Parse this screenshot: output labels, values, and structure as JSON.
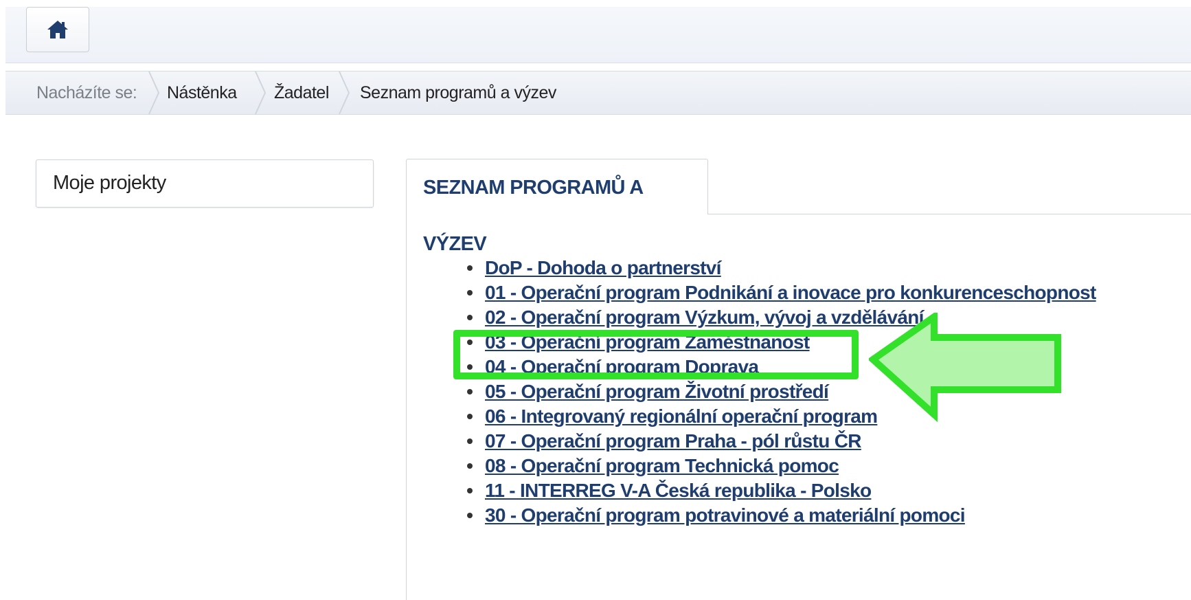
{
  "header": {
    "home_icon": "home-icon"
  },
  "breadcrumb": {
    "prefix": "Nacházíte se:",
    "items": [
      "Nástěnka",
      "Žadatel",
      "Seznam programů a výzev"
    ]
  },
  "sidebar": {
    "my_projects_label": "Moje projekty"
  },
  "main": {
    "tab_label": "SEZNAM PROGRAMŮ A VÝZEV",
    "programs": [
      "DoP - Dohoda o partnerství",
      "01 - Operační program Podnikání a inovace pro konkurenceschopnost",
      "02 - Operační program Výzkum, vývoj a vzdělávání",
      "03 - Operační program Zaměstnanost",
      "04 - Operační program Doprava",
      "05 - Operační program Životní prostředí",
      "06 - Integrovaný regionální operační program",
      "07 - Operační program Praha - pól růstu ČR",
      "08 - Operační program Technická pomoc",
      "11 - INTERREG V-A Česká republika - Polsko",
      "30 - Operační program potravinové a materiální pomoci"
    ],
    "highlighted_index": 3
  },
  "colors": {
    "link": "#1f3e6e",
    "highlight": "#33e02a",
    "arrow_fill": "#a6f29c"
  }
}
